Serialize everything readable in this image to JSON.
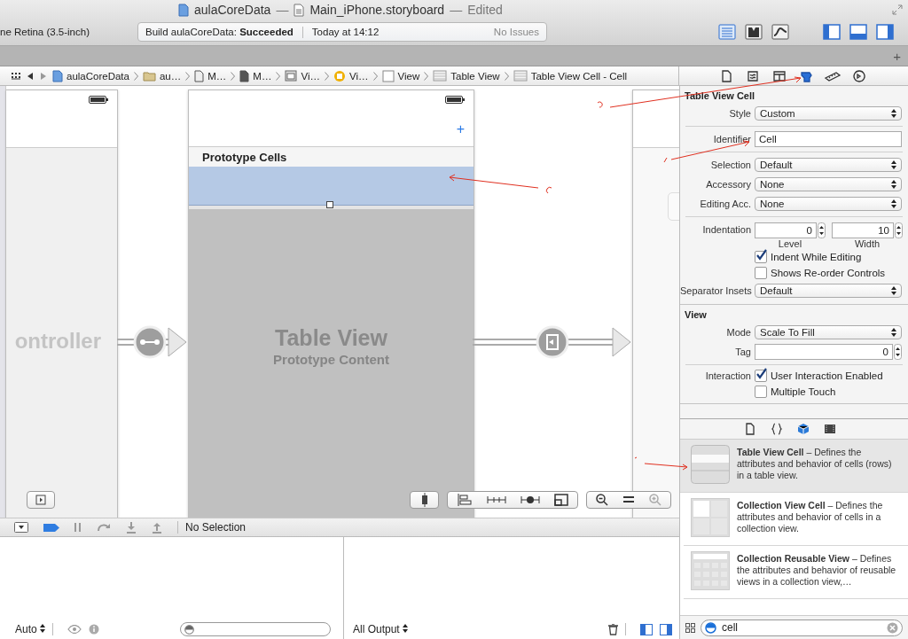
{
  "window": {
    "project": "aulaCoreData",
    "separator_1": "—",
    "file": "Main_iPhone.storyboard",
    "separator_2": "—",
    "status": "Edited"
  },
  "toolbar": {
    "scheme": "ne Retina (3.5-inch)",
    "activity": {
      "text": "Build aulaCoreData: **Succeeded**",
      "time": "Today at 14:12",
      "issues": "No Issues"
    },
    "view_buttons": [
      {
        "kind": "standard",
        "selected": true
      },
      {
        "kind": "assistant",
        "selected": false
      },
      {
        "kind": "version",
        "selected": false
      }
    ],
    "panel_buttons": [
      {
        "kind": "navigator",
        "selected": true
      },
      {
        "kind": "debug",
        "selected": true
      },
      {
        "kind": "utilities",
        "selected": true
      }
    ]
  },
  "tab_bar": {
    "add": "+"
  },
  "jump_bar": [
    {
      "kind": "project",
      "label": "aulaCoreData"
    },
    {
      "kind": "folder",
      "label": "au…"
    },
    {
      "kind": "file",
      "label": "M…"
    },
    {
      "kind": "file-dark",
      "label": "M…"
    },
    {
      "kind": "scene",
      "label": "Vi…"
    },
    {
      "kind": "controller",
      "label": "Vi…"
    },
    {
      "kind": "view",
      "label": "View"
    },
    {
      "kind": "table",
      "label": "Table View"
    },
    {
      "kind": "table",
      "label": "Table View Cell - Cell"
    }
  ],
  "inspector_tabs": [
    {
      "kind": "file",
      "selected": false
    },
    {
      "kind": "help",
      "selected": false
    },
    {
      "kind": "identity",
      "selected": false
    },
    {
      "kind": "attributes",
      "selected": true
    },
    {
      "kind": "size",
      "selected": false
    },
    {
      "kind": "connections",
      "selected": false
    }
  ],
  "canvas": {
    "left_scene": {
      "title": "ontroller"
    },
    "table_scene": {
      "add": "+",
      "header": "Prototype Cells",
      "title": "Table View",
      "subtitle": "Prototype Content"
    }
  },
  "inspector": [
    {
      "title": "Table View Cell",
      "rows": [
        {
          "kind": "popup",
          "label": "Style",
          "value": "Custom"
        },
        {
          "kind": "divider"
        },
        {
          "kind": "text",
          "label": "Identifier",
          "value": "Cell"
        },
        {
          "kind": "divider"
        },
        {
          "kind": "popup",
          "label": "Selection",
          "value": "Default"
        },
        {
          "kind": "popup",
          "label": "Accessory",
          "value": "None"
        },
        {
          "kind": "popup",
          "label": "Editing Acc.",
          "value": "None"
        },
        {
          "kind": "divider"
        },
        {
          "kind": "steppers",
          "label": "Indentation",
          "fields": [
            {
              "value": "0",
              "caption": "Level"
            },
            {
              "value": "10",
              "caption": "Width"
            }
          ]
        },
        {
          "kind": "checkbox",
          "text": "Indent While Editing",
          "checked": true
        },
        {
          "kind": "checkbox",
          "text": "Shows Re-order Controls",
          "checked": false
        },
        {
          "kind": "popup",
          "label": "Separator Insets",
          "value": "Default"
        }
      ]
    },
    {
      "title": "View",
      "rows": [
        {
          "kind": "popup",
          "label": "Mode",
          "value": "Scale To Fill"
        },
        {
          "kind": "stepper",
          "label": "Tag",
          "value": "0"
        },
        {
          "kind": "divider"
        },
        {
          "kind": "checkbox",
          "label": "Interaction",
          "text": "User Interaction Enabled",
          "checked": true
        },
        {
          "kind": "checkbox",
          "text": "Multiple Touch",
          "checked": false
        }
      ]
    }
  ],
  "library_tabs": [
    {
      "kind": "file",
      "selected": false
    },
    {
      "kind": "code",
      "selected": false
    },
    {
      "kind": "object",
      "selected": true
    },
    {
      "kind": "media",
      "selected": false
    }
  ],
  "library": [
    {
      "kind": "table-cell",
      "text": "**Table View Cell** – Defines the attributes and behavior of cells (rows) in a table view.",
      "selected": true
    },
    {
      "kind": "collection-cell",
      "text": "**Collection View Cell** – Defines the attributes and behavior of cells in a collection view.",
      "selected": false
    },
    {
      "kind": "reusable-view",
      "text": "**Collection Reusable View** – Defines the attributes and behavior of reusable views in a collection view,…",
      "selected": false
    }
  ],
  "library_search": {
    "value": "cell"
  },
  "debug": {
    "selection": "No Selection",
    "variables_scope": "Auto",
    "console_scope": "All Output"
  }
}
